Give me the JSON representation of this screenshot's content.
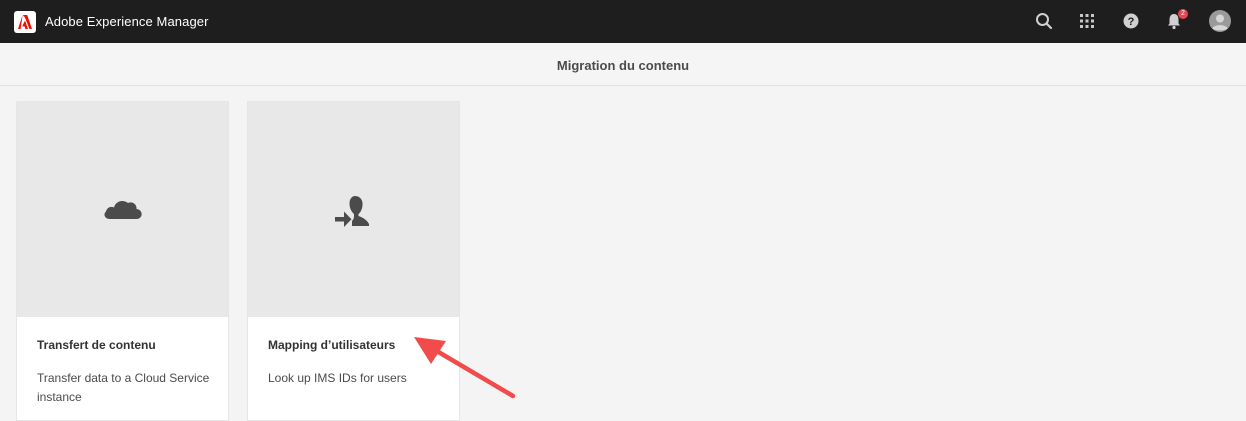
{
  "header": {
    "app_name": "Adobe Experience Manager",
    "notification_count": "2",
    "icons": [
      "search-icon",
      "apps-grid-icon",
      "help-icon",
      "bell-icon",
      "user-avatar-icon"
    ]
  },
  "page": {
    "title": "Migration du contenu"
  },
  "cards": [
    {
      "title": "Transfert de contenu",
      "description": "Transfer data to a Cloud Service instance",
      "icon": "cloud-icon"
    },
    {
      "title": "Mapping d’utilisateurs",
      "description": "Look up IMS IDs for users",
      "icon": "user-mapping-icon"
    }
  ],
  "colors": {
    "topbar": "#1e1e1e",
    "adobe_red": "#eb1000",
    "annotation_arrow": "#f24b4b",
    "page_bg": "#f4f4f4",
    "thumb_bg": "#e8e8e8"
  }
}
